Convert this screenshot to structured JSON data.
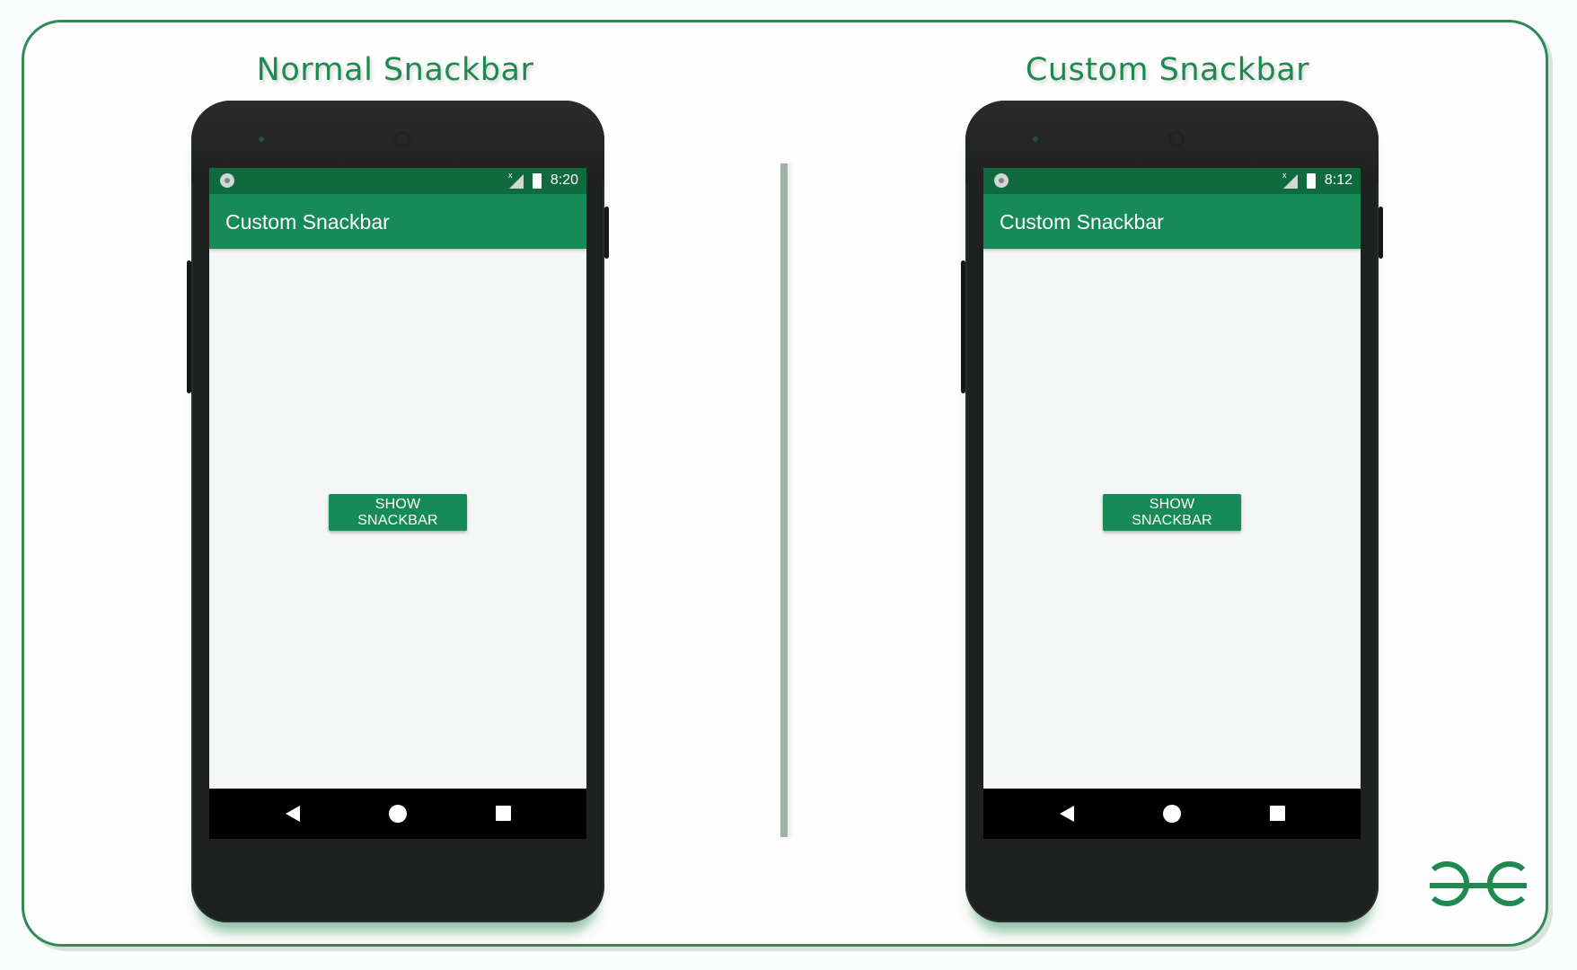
{
  "panels": [
    {
      "heading": "Normal Snackbar",
      "status_time": "8:20",
      "app_title": "Custom Snackbar",
      "button_label": "SHOW SNACKBAR"
    },
    {
      "heading": "Custom Snackbar",
      "status_time": "8:12",
      "app_title": "Custom Snackbar",
      "button_label": "SHOW SNACKBAR"
    }
  ],
  "icons": {
    "status": [
      "notification-circle-icon",
      "signal-icon",
      "battery-icon"
    ],
    "nav": [
      "back-icon",
      "home-icon",
      "recents-icon"
    ],
    "logo": "gfg-logo-icon"
  },
  "colors": {
    "accent": "#168b57",
    "status_bar": "#0f6b3d",
    "frame": "#2e8b57",
    "phone_body": "#1f2020"
  }
}
